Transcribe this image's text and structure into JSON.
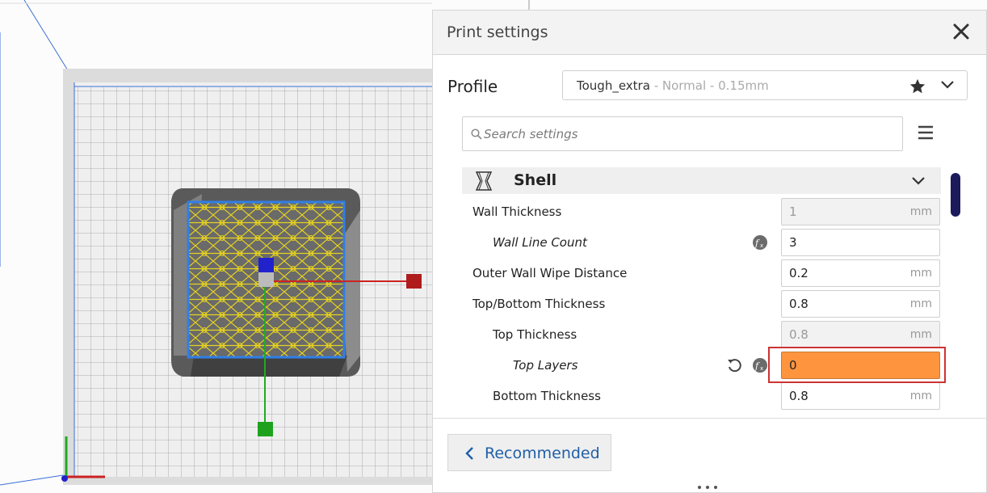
{
  "panel": {
    "title": "Print settings",
    "profile": {
      "label": "Profile",
      "name": "Tough_extra",
      "detail": " - Normal - 0.15mm"
    },
    "search": {
      "placeholder": "Search settings",
      "value": ""
    },
    "category": {
      "name": "Shell",
      "icon": "shell-icon"
    },
    "settings": [
      {
        "label": "Wall Thickness",
        "value": "1",
        "unit": "mm",
        "indent": 0,
        "italic": false,
        "disabled": true,
        "fx": false,
        "reset": false,
        "error": false
      },
      {
        "label": "Wall Line Count",
        "value": "3",
        "unit": "",
        "indent": 1,
        "italic": true,
        "disabled": false,
        "fx": true,
        "reset": false,
        "error": false
      },
      {
        "label": "Outer Wall Wipe Distance",
        "value": "0.2",
        "unit": "mm",
        "indent": 0,
        "italic": false,
        "disabled": false,
        "fx": false,
        "reset": false,
        "error": false
      },
      {
        "label": "Top/Bottom Thickness",
        "value": "0.8",
        "unit": "mm",
        "indent": 0,
        "italic": false,
        "disabled": false,
        "fx": false,
        "reset": false,
        "error": false
      },
      {
        "label": "Top Thickness",
        "value": "0.8",
        "unit": "mm",
        "indent": 1,
        "italic": false,
        "disabled": true,
        "fx": false,
        "reset": false,
        "error": false
      },
      {
        "label": "Top Layers",
        "value": "0",
        "unit": "",
        "indent": 2,
        "italic": true,
        "disabled": false,
        "fx": true,
        "reset": true,
        "error": true
      },
      {
        "label": "Bottom Thickness",
        "value": "0.8",
        "unit": "mm",
        "indent": 1,
        "italic": false,
        "disabled": false,
        "fx": false,
        "reset": false,
        "error": false
      }
    ],
    "recommended_label": "Recommended"
  },
  "colors": {
    "accent": "#1f5fa8",
    "error_field": "#ff943f",
    "highlight": "#cc3333",
    "scrollbar": "#1a1a5c",
    "x_axis": "#cc2222",
    "y_axis": "#22aa22",
    "z_axis": "#2222cc",
    "infill": "#e6d21e"
  }
}
